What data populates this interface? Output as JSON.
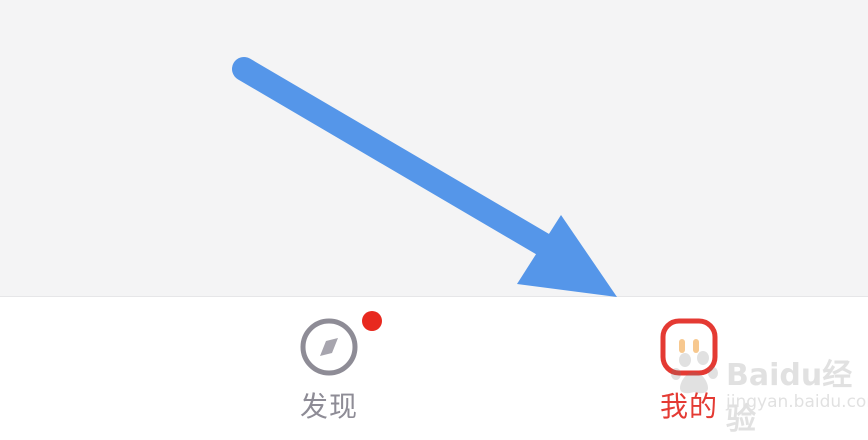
{
  "tab_bar": {
    "tabs": [
      {
        "id": "discover",
        "label": "发现",
        "icon": "compass-icon",
        "has_badge": true,
        "active": false
      },
      {
        "id": "mine",
        "label": "我的",
        "icon": "profile-face-icon",
        "has_badge": false,
        "active": true
      }
    ]
  },
  "watermark": {
    "brand": "Baidu经验",
    "url": "jingyan.baidu.com"
  },
  "colors": {
    "background": "#f4f4f5",
    "tab_bar": "#ffffff",
    "inactive": "#8e8c96",
    "active": "#e43a33",
    "badge": "#e8291f",
    "annotation_arrow": "#5596e9"
  }
}
